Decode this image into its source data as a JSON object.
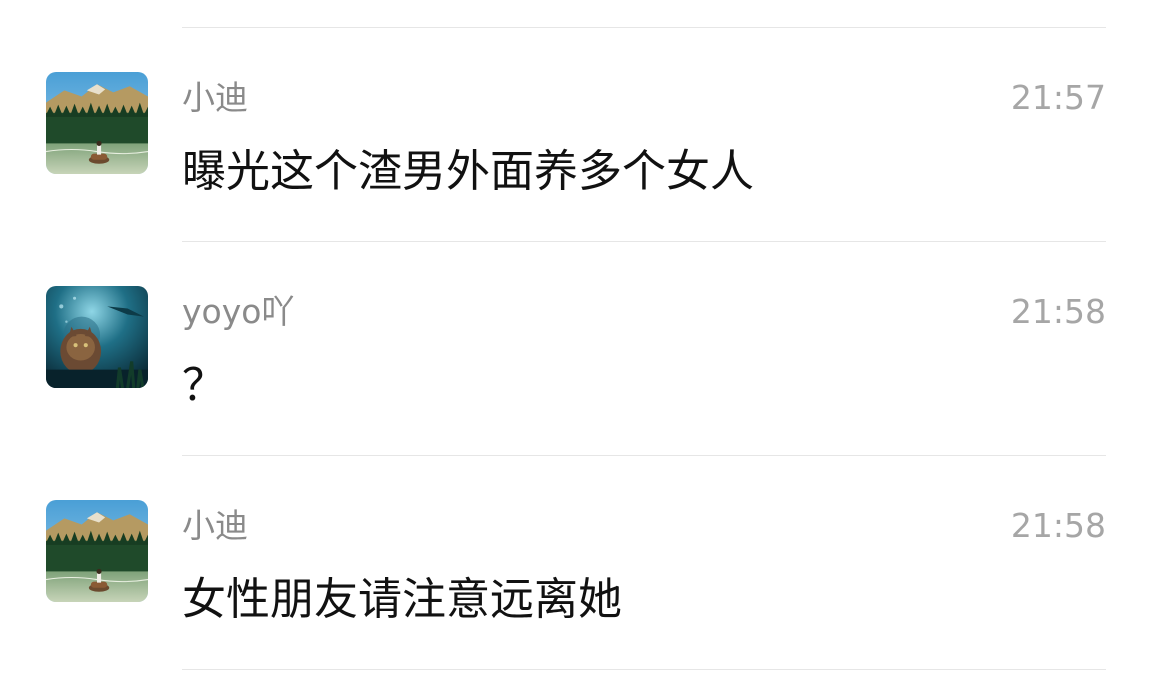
{
  "messages": [
    {
      "sender": "小迪",
      "time": "21:57",
      "text": "曝光这个渣男外面养多个女人",
      "avatar_icon": "mountain-lake-horse-avatar"
    },
    {
      "sender": "yoyo吖",
      "time": "21:58",
      "text": "？",
      "avatar_icon": "underwater-cat-avatar"
    },
    {
      "sender": "小迪",
      "time": "21:58",
      "text": "女性朋友请注意远离她",
      "avatar_icon": "mountain-lake-horse-avatar"
    }
  ],
  "colors": {
    "sender": "#8a8a8a",
    "time": "#a6a6a6",
    "message": "#111111",
    "divider": "#e6e6e6"
  }
}
